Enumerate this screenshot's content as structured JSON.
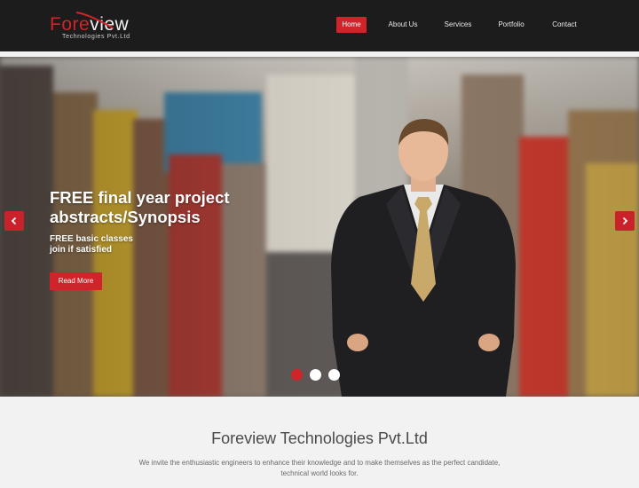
{
  "brand": {
    "logo_part1": "Fore",
    "logo_part2": "view",
    "logo_tagline": "Technologies Pvt.Ltd",
    "accent_color": "#d0242a"
  },
  "nav": {
    "items": [
      {
        "label": "Home",
        "active": true
      },
      {
        "label": "About Us",
        "active": false
      },
      {
        "label": "Services",
        "active": false
      },
      {
        "label": "Portfolio",
        "active": false
      },
      {
        "label": "Contact",
        "active": false
      }
    ]
  },
  "hero": {
    "title_line1": "FREE final year project",
    "title_line2": "abstracts/Synopsis",
    "sub_line1": "FREE basic classes",
    "sub_line2": "join if satisfied",
    "button_label": "Read More",
    "prev_icon": "chevron-left-icon",
    "next_icon": "chevron-right-icon",
    "slide_count": 3,
    "active_slide": 1
  },
  "intro": {
    "title": "Foreview Technologies Pvt.Ltd",
    "text_line1": "We invite the enthusiastic engineers to enhance their knowledge and to make themselves as the perfect candidate,",
    "text_line2": "technical world looks for."
  }
}
